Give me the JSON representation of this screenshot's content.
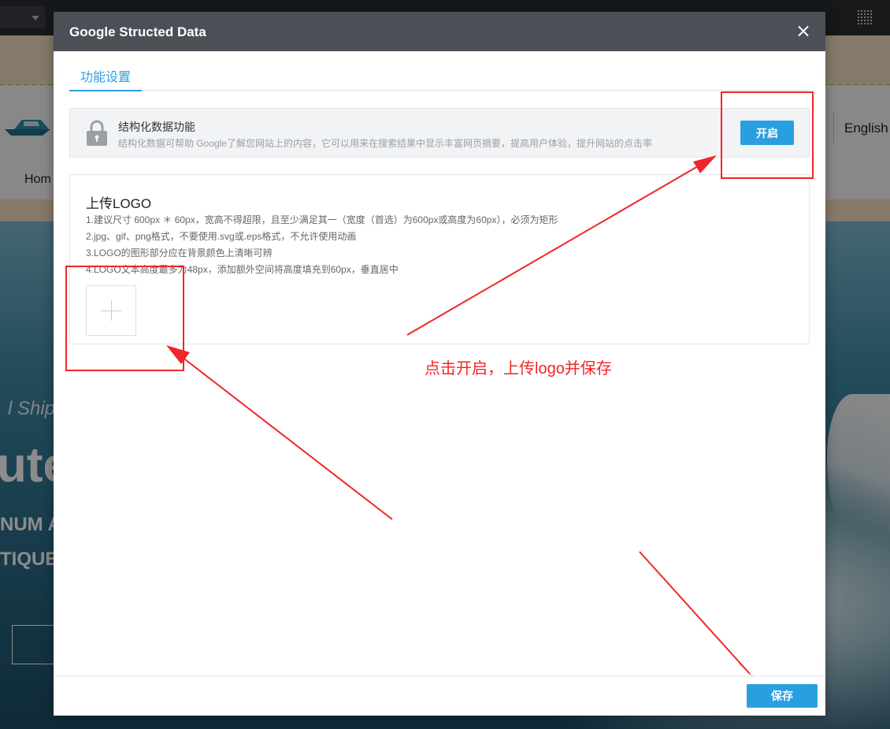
{
  "background": {
    "nav_home": "Hom",
    "nav_language": "English",
    "hero_line1": "l Ship I",
    "hero_line2": "ute",
    "hero_line3": "NUM A",
    "hero_line4": "TIQUE"
  },
  "modal": {
    "title": "Google Structed Data",
    "tabs": [
      {
        "label": "功能设置"
      }
    ],
    "feature": {
      "title": "结构化数据功能",
      "description": "结构化数据可帮助 Google了解您网站上的内容，它可以用来在搜索结果中显示丰富网页摘要，提高用户体验，提升网站的点击率",
      "enable_label": "开启"
    },
    "upload": {
      "title": "上传LOGO",
      "rules": [
        "1.建议尺寸 600px ＊ 60px，宽高不得超限，且至少满足其一（宽度（首选）为600px或高度为60px），必须为矩形",
        "2.jpg、gif、png格式，不要使用.svg或.eps格式，不允许使用动画",
        "3.LOGO的图形部分应在背景颜色上清晰可辨",
        "4.LOGO文本高度最多为48px，添加额外空间将高度填充到60px，垂直居中"
      ]
    },
    "save_label": "保存"
  },
  "annotation": {
    "text": "点击开启，上传logo并保存",
    "color": "#f0262a"
  },
  "colors": {
    "accent": "#2a9fe0",
    "modal_header": "#4b4f56"
  }
}
